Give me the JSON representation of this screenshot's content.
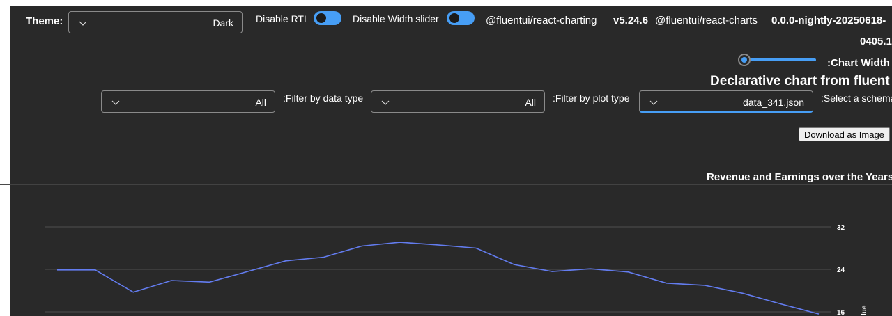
{
  "theme": {
    "label": "Theme:",
    "value": "Dark"
  },
  "toggles": [
    {
      "label": "Disable RTL",
      "state": "on"
    },
    {
      "label": "Disable Width slider",
      "state": "on"
    }
  ],
  "versions": {
    "charting_pkg": "@fluentui/react-charting",
    "charting_ver": "v5.24.6",
    "charts_pkg": "@fluentui/react-charts",
    "charts_ver": "0.0.0-nightly-20250618-",
    "charts_ver_cont": "0405.1"
  },
  "width_slider": {
    "label": ":Chart Width"
  },
  "heading": "Declarative chart from fluent",
  "filters": {
    "data_type": {
      "label": ":Filter by data type",
      "value": "All"
    },
    "plot_type": {
      "label": ":Filter by plot type",
      "value": "All"
    },
    "schema": {
      "label": ":Select a schema",
      "value": "data_341.json"
    }
  },
  "download_button": "Download as Image",
  "chart_data": {
    "type": "line",
    "title": "Revenue and Earnings over the Years",
    "ylabel": "lue",
    "y_ticks": [
      "32",
      "24",
      "16"
    ],
    "ylim": [
      16,
      32
    ],
    "series": [
      {
        "color": "#637cef",
        "values": [
          23.9,
          23.9,
          19.7,
          21.9,
          21.6,
          23.6,
          25.6,
          26.3,
          28.4,
          29.1,
          28.6,
          28.0,
          24.9,
          23.6,
          24.1,
          23.5,
          21.4,
          21.0,
          19.5,
          17.5,
          15.6
        ]
      }
    ]
  }
}
